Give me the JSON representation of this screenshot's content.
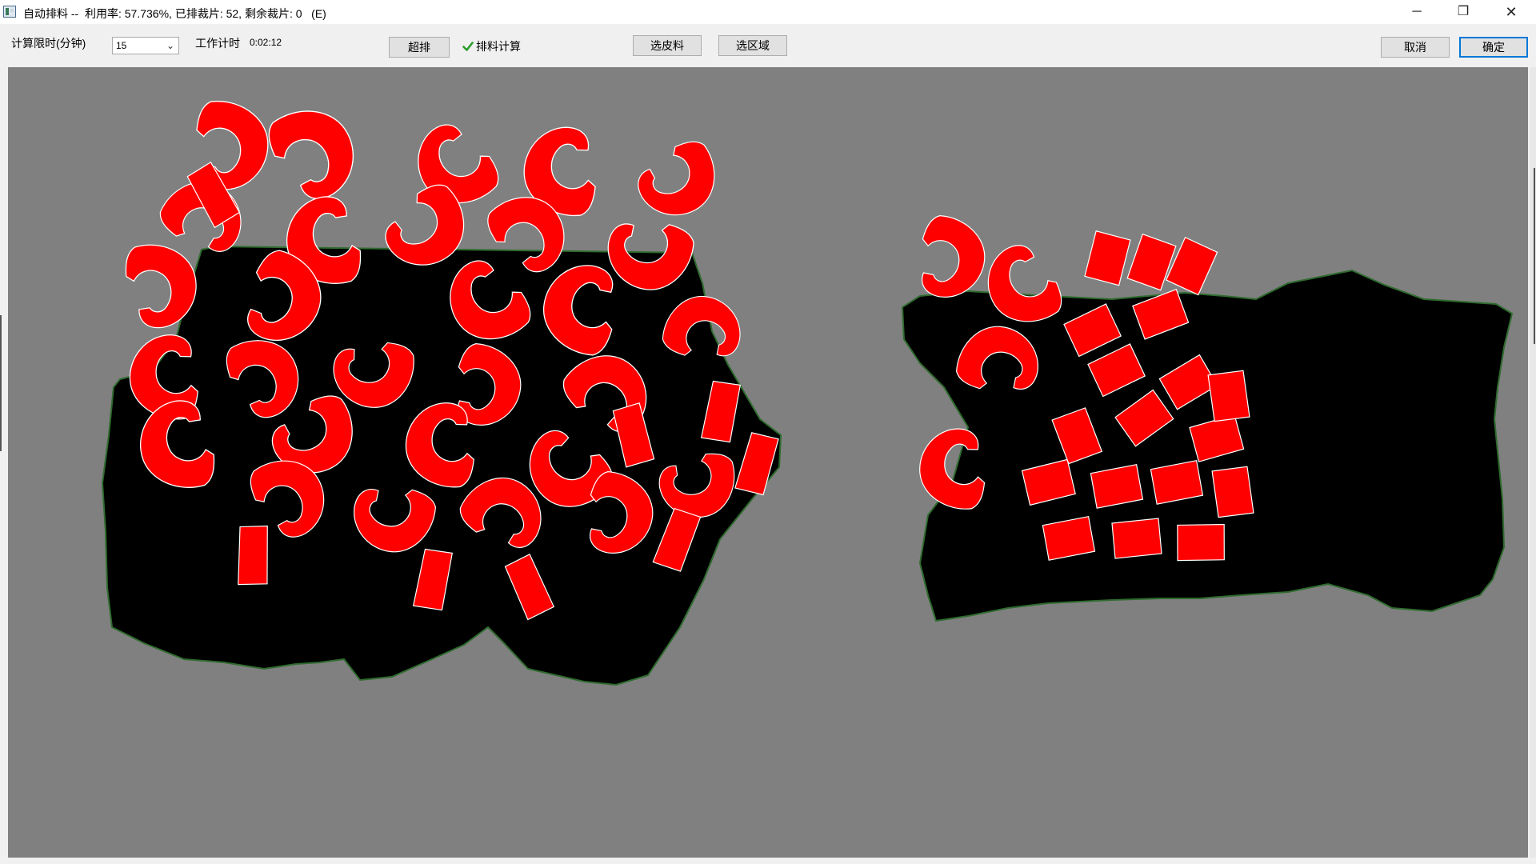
{
  "window": {
    "title": "自动排料 --  利用率: 57.736%, 已排裁片: 52, 剩余裁片: 0   (E)",
    "minimize_glyph": "─",
    "maximize_glyph": "❐",
    "close_glyph": "✕"
  },
  "toolbar": {
    "time_limit_label": "计算限时(分钟)",
    "time_limit_value": "15",
    "work_timer_label": "工作计时",
    "work_timer_value": "0:02:12",
    "super_nest_label": "超排",
    "nest_calc_label": "排料计算",
    "nest_calc_checked": true,
    "select_leather_label": "选皮料",
    "select_region_label": "选区域",
    "cancel_label": "取消",
    "ok_label": "确定"
  },
  "nesting": {
    "utilization_percent": 57.736,
    "pieces_placed": 52,
    "pieces_remaining": 0,
    "hide_count": 2,
    "colors": {
      "background": "#808080",
      "hide": "#000000",
      "hide_outline": "#2e6b2e",
      "piece_fill": "#ff0000",
      "piece_outline": "#ffffff"
    }
  }
}
